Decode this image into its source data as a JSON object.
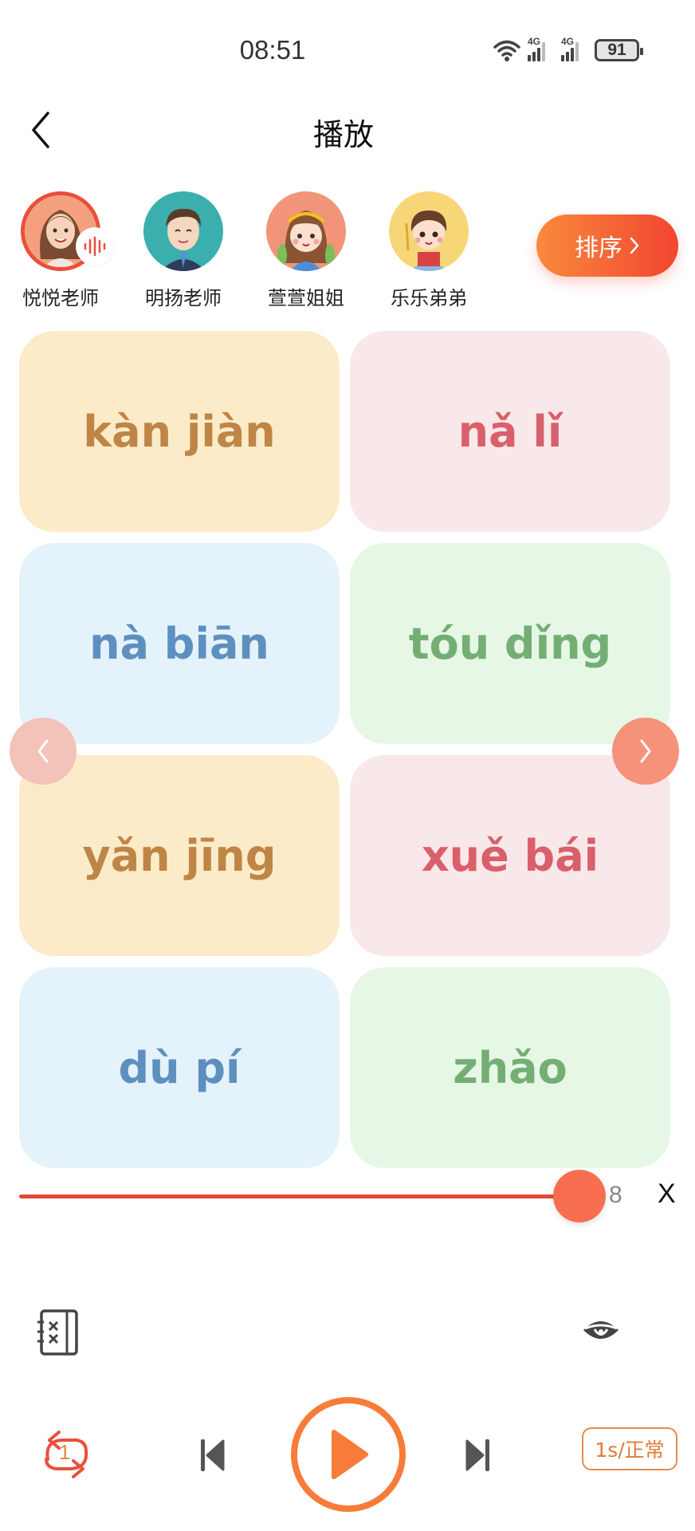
{
  "status_bar": {
    "time": "08:51",
    "network_1": "4G",
    "network_2": "4G",
    "battery": "91"
  },
  "header": {
    "title": "播放",
    "back_icon": "chevron-left-icon"
  },
  "speakers": [
    {
      "name": "悦悦老师",
      "selected": true,
      "bg": "#f4a07f"
    },
    {
      "name": "明扬老师",
      "selected": false,
      "bg": "#3aafad"
    },
    {
      "name": "萱萱姐姐",
      "selected": false,
      "bg": "#f29478"
    },
    {
      "name": "乐乐弟弟",
      "selected": false,
      "bg": "#f7d678"
    }
  ],
  "sort_button": {
    "label": "排序",
    "icon": "chevron-right-icon"
  },
  "cards": [
    {
      "pinyin": "kàn jiàn",
      "color": "yellow"
    },
    {
      "pinyin": "nǎ lǐ",
      "color": "pink"
    },
    {
      "pinyin": "nà biān",
      "color": "blue"
    },
    {
      "pinyin": "tóu dǐng",
      "color": "green"
    },
    {
      "pinyin": "yǎn jīng",
      "color": "yellow"
    },
    {
      "pinyin": "xuě bái",
      "color": "pink"
    },
    {
      "pinyin": "dù pí",
      "color": "blue"
    },
    {
      "pinyin": "zhǎo",
      "color": "green"
    }
  ],
  "slider": {
    "value": 8,
    "max": 8,
    "label": "8",
    "close_label": "X"
  },
  "tools": {
    "notebook_icon": "notebook-icon",
    "eye_icon": "eye-icon"
  },
  "player": {
    "repeat_count": "1",
    "speed_label": "1s/正常",
    "colors": {
      "accent": "#f77c3a",
      "slider": "#e04a34",
      "thumb": "#f76e50"
    }
  }
}
